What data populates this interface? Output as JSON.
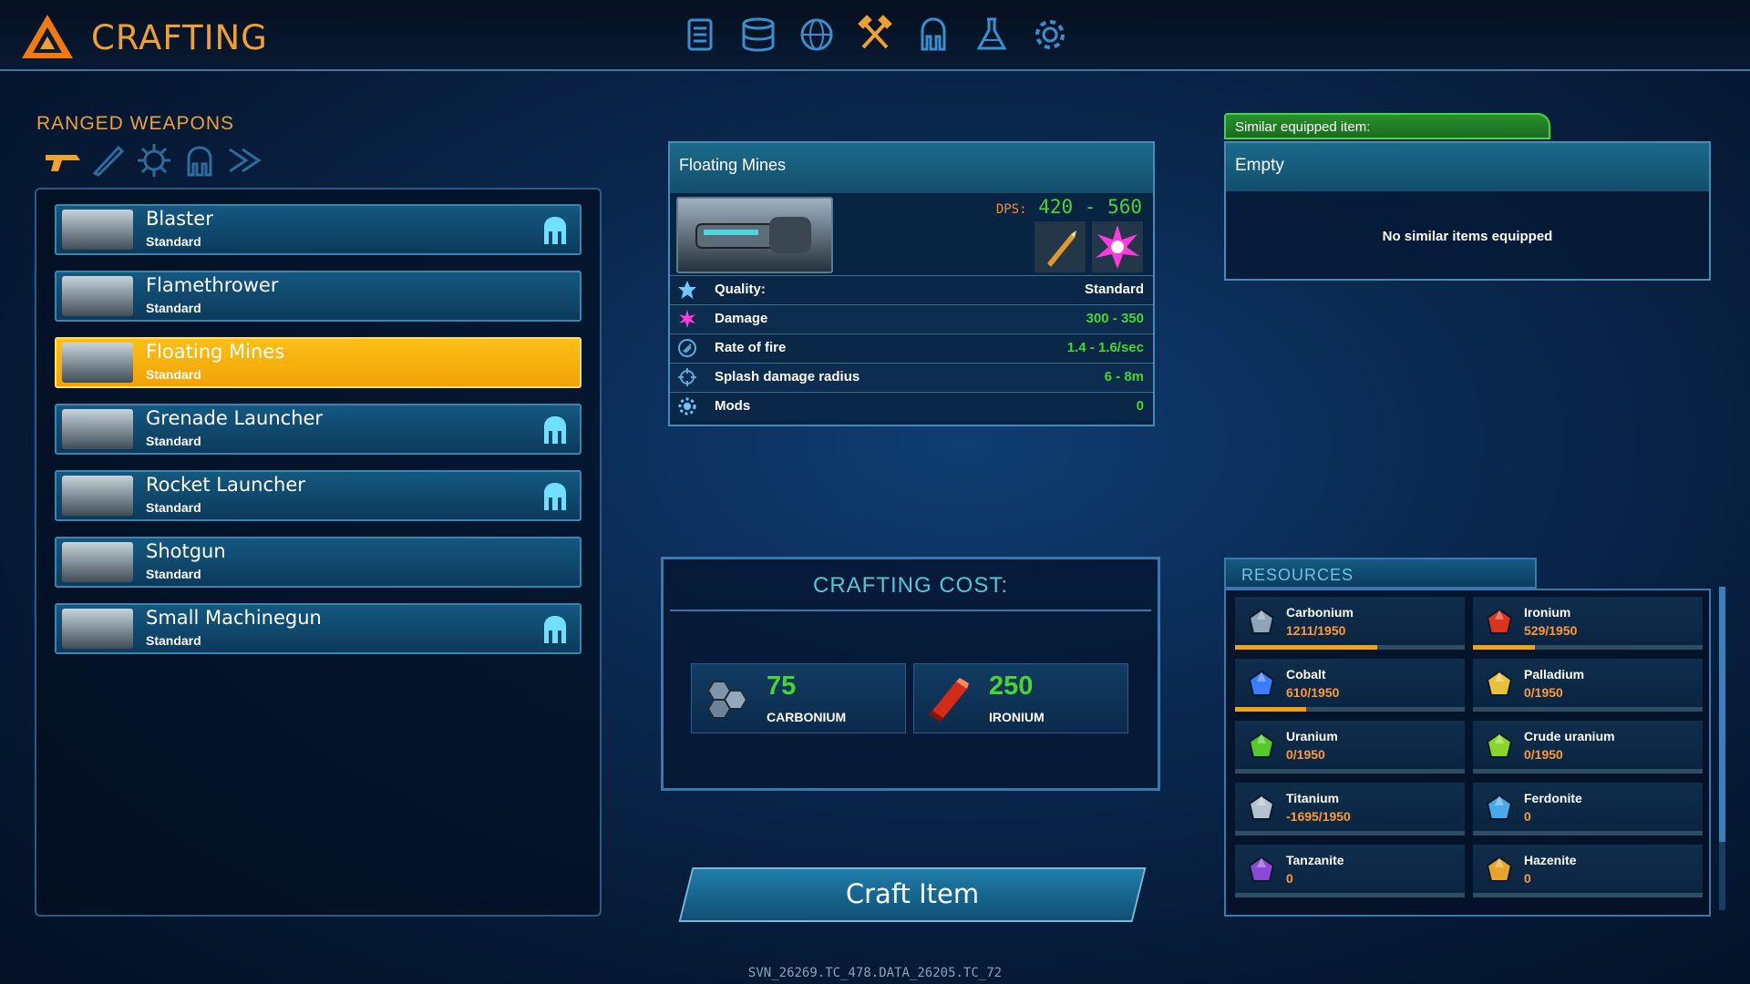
{
  "header": {
    "title": "CRAFTING",
    "accent": "#f0a030"
  },
  "nav": [
    "list-icon",
    "database-icon",
    "globe-icon",
    "crafting-hammers-icon",
    "mech-icon",
    "flask-icon",
    "gear-icon"
  ],
  "nav_active": "crafting-hammers-icon",
  "category": {
    "title": "RANGED WEAPONS",
    "icons": [
      "pistol-icon",
      "melee-blade-icon",
      "explosive-icon",
      "mech-icon",
      "drone-icon"
    ]
  },
  "weapons": [
    {
      "name": "Blaster",
      "quality": "Standard",
      "mech": true
    },
    {
      "name": "Flamethrower",
      "quality": "Standard",
      "mech": false
    },
    {
      "name": "Floating Mines",
      "quality": "Standard",
      "mech": false,
      "selected": true
    },
    {
      "name": "Grenade Launcher",
      "quality": "Standard",
      "mech": true
    },
    {
      "name": "Rocket Launcher",
      "quality": "Standard",
      "mech": true
    },
    {
      "name": "Shotgun",
      "quality": "Standard",
      "mech": false
    },
    {
      "name": "Small Machinegun",
      "quality": "Standard",
      "mech": true
    }
  ],
  "item": {
    "name": "Floating Mines",
    "dps_label": "DPS:",
    "dps_value": "420 - 560",
    "stats": [
      {
        "icon": "star-icon",
        "label": "Quality:",
        "value": "Standard"
      },
      {
        "icon": "damage-burst-icon",
        "label": "Damage",
        "value": "300 - 350"
      },
      {
        "icon": "rate-of-fire-icon",
        "label": "Rate of fire",
        "value": "1.4 - 1.6/sec"
      },
      {
        "icon": "crosshair-icon",
        "label": "Splash damage radius",
        "value": "6 - 8m"
      },
      {
        "icon": "gear-icon",
        "label": "Mods",
        "value": "0"
      }
    ]
  },
  "similar": {
    "tag": "Similar equipped item:",
    "title": "Empty",
    "message": "No similar items equipped"
  },
  "cost": {
    "title": "CRAFTING COST:",
    "items": [
      {
        "amount": "75",
        "name": "CARBONIUM",
        "icon": "carbonium-icon"
      },
      {
        "amount": "250",
        "name": "IRONIUM",
        "icon": "ironium-icon"
      }
    ]
  },
  "craft_button": "Craft Item",
  "resources": {
    "title": "RESOURCES",
    "items": [
      {
        "name": "Carbonium",
        "value": "1211/1950",
        "fill": 0.62,
        "icon": "carbonium-icon",
        "color": "#8ea4b8"
      },
      {
        "name": "Ironium",
        "value": "529/1950",
        "fill": 0.27,
        "icon": "ironium-icon",
        "color": "#d8341f"
      },
      {
        "name": "Cobalt",
        "value": "610/1950",
        "fill": 0.31,
        "icon": "cobalt-icon",
        "color": "#3b7dff"
      },
      {
        "name": "Palladium",
        "value": "0/1950",
        "fill": 0,
        "icon": "palladium-icon",
        "color": "#e8c13a"
      },
      {
        "name": "Uranium",
        "value": "0/1950",
        "fill": 0,
        "icon": "uranium-icon",
        "color": "#54c92a"
      },
      {
        "name": "Crude uranium",
        "value": "0/1950",
        "fill": 0,
        "icon": "crude-uranium-icon",
        "color": "#8ad42c"
      },
      {
        "name": "Titanium",
        "value": "-1695/1950",
        "fill": 0,
        "icon": "titanium-icon",
        "color": "#b6c2cd"
      },
      {
        "name": "Ferdonite",
        "value": "0",
        "fill": 0,
        "icon": "ferdonite-icon",
        "color": "#4aa8e8"
      },
      {
        "name": "Tanzanite",
        "value": "0",
        "fill": 0,
        "icon": "tanzanite-icon",
        "color": "#8a48d8"
      },
      {
        "name": "Hazenite",
        "value": "0",
        "fill": 0,
        "icon": "hazenite-icon",
        "color": "#e8a52a"
      }
    ]
  },
  "footer": "SVN_26269.TC_478.DATA_26205.TC_72"
}
